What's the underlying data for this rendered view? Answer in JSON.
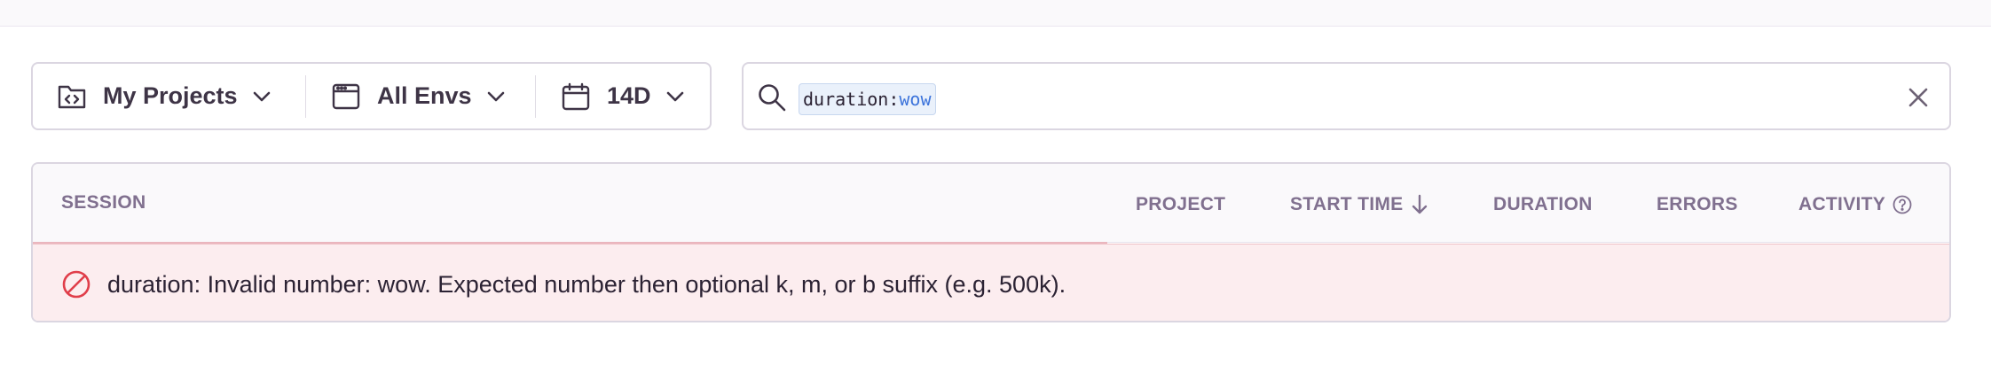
{
  "filters": {
    "projects_label": "My Projects",
    "envs_label": "All Envs",
    "date_label": "14D"
  },
  "search": {
    "token_key": "duration:",
    "token_value": "wow"
  },
  "table": {
    "columns": {
      "session": "Session",
      "project": "Project",
      "start_time": "Start Time",
      "duration": "Duration",
      "errors": "Errors",
      "activity": "Activity"
    },
    "error_message": "duration: Invalid number: wow. Expected number then optional k, m, or b suffix (e.g. 500k)."
  },
  "colors": {
    "accent_blue": "#3d74db",
    "error_red": "#e03e4a",
    "header_text": "#80708f"
  },
  "icons": [
    "folder-code-icon",
    "chevron-down-icon",
    "browser-window-icon",
    "calendar-icon",
    "search-icon",
    "close-icon",
    "arrow-down-icon",
    "question-circle-icon",
    "prohibited-icon"
  ]
}
